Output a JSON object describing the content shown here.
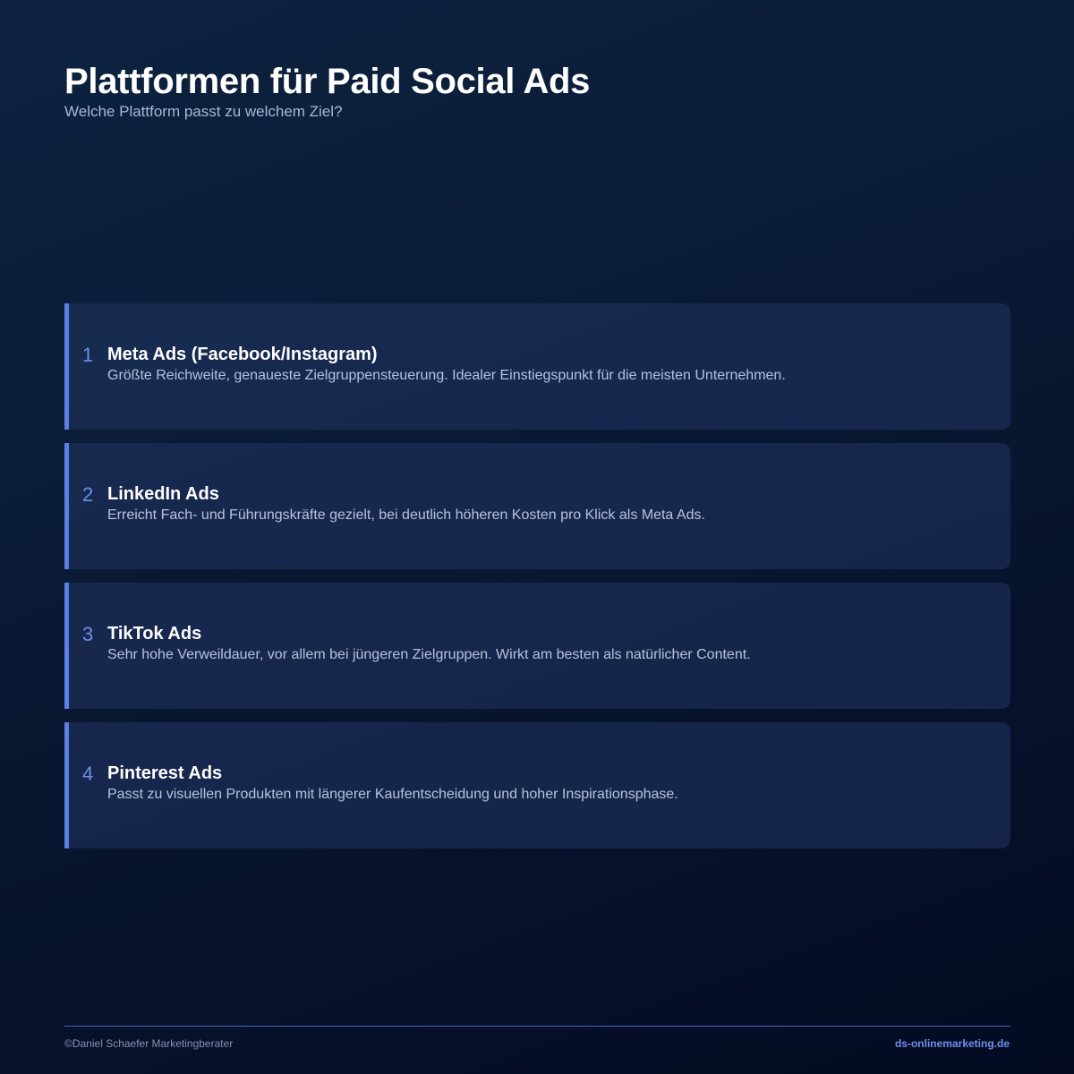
{
  "header": {
    "title": "Plattformen für Paid Social Ads",
    "subtitle": "Welche Plattform passt zu welchem Ziel?"
  },
  "platforms": [
    {
      "number": "1",
      "title": "Meta Ads (Facebook/Instagram)",
      "description": "Größte Reichweite, genaueste Zielgruppensteuerung. Idealer Einstiegspunkt für die meisten Unternehmen."
    },
    {
      "number": "2",
      "title": "LinkedIn Ads",
      "description": "Erreicht Fach- und Führungskräfte gezielt, bei deutlich höheren Kosten pro Klick als Meta Ads."
    },
    {
      "number": "3",
      "title": "TikTok Ads",
      "description": "Sehr hohe Verweildauer, vor allem bei jüngeren Zielgruppen. Wirkt am besten als natürlicher Content."
    },
    {
      "number": "4",
      "title": "Pinterest Ads",
      "description": "Passt zu visuellen Produkten mit längerer Kaufentscheidung und hoher Inspirationsphase."
    }
  ],
  "footer": {
    "copyright": "©Daniel Schaefer Marketingberater",
    "website": "ds-onlinemarketing.de"
  },
  "colors": {
    "accent": "#5b7fe6",
    "background": "#0a1a34",
    "card": "#1b2a52"
  }
}
